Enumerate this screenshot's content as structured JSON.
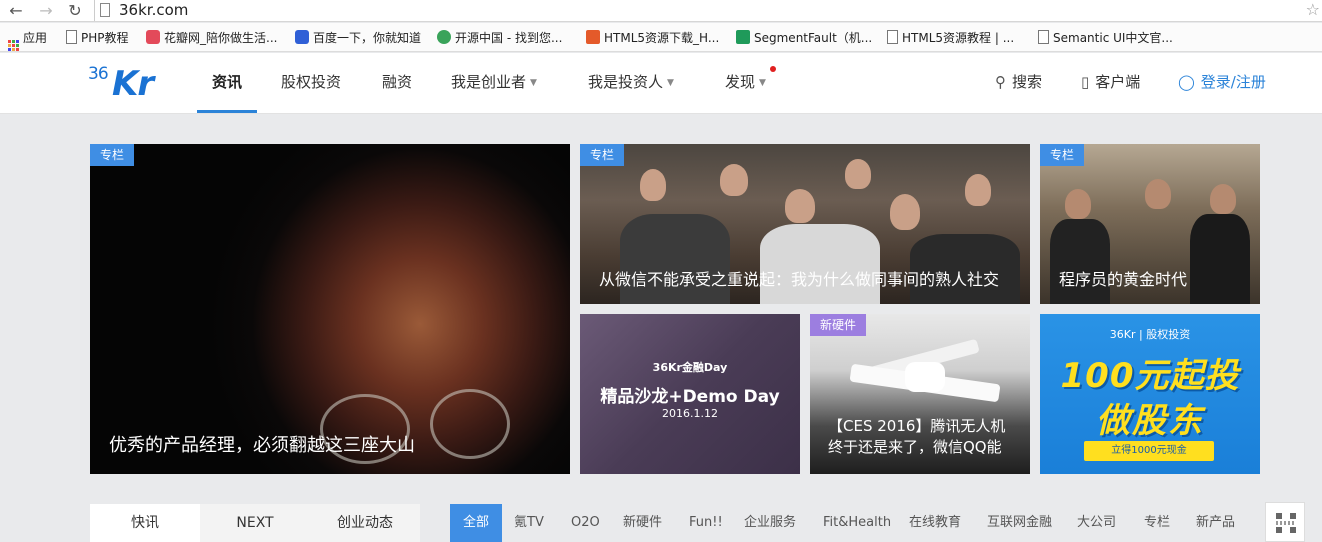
{
  "browser": {
    "url": "36kr.com",
    "bookmarks": [
      {
        "label": "应用",
        "icon": "apps-grid-icon"
      },
      {
        "label": "PHP教程",
        "icon": "page-icon"
      },
      {
        "label": "花瓣网_陪你做生活...",
        "icon": "huaban-icon"
      },
      {
        "label": "百度一下，你就知道",
        "icon": "baidu-paw-icon"
      },
      {
        "label": "开源中国 - 找到您...",
        "icon": "oschina-icon"
      },
      {
        "label": "HTML5资源下载_H...",
        "icon": "html5-icon"
      },
      {
        "label": "SegmentFault（机...",
        "icon": "segmentfault-icon"
      },
      {
        "label": "HTML5资源教程 | ...",
        "icon": "page-icon"
      },
      {
        "label": "Semantic UI中文官...",
        "icon": "page-icon"
      }
    ]
  },
  "header": {
    "logo_num": "36",
    "logo_kr": "Kr",
    "nav": [
      "资讯",
      "股权投资",
      "融资",
      "我是创业者",
      "我是投资人",
      "发现"
    ],
    "search": "搜索",
    "client": "客户端",
    "login": "登录/注册"
  },
  "cards": {
    "hero": {
      "tag": "专栏",
      "title": "优秀的产品经理，必须翻越这三座大山"
    },
    "c2": {
      "tag": "专栏",
      "title": "从微信不能承受之重说起：我为什么做同事间的熟人社交"
    },
    "c3": {
      "tag": "专栏",
      "title": "程序员的黄金时代"
    },
    "c4": {
      "line1": "36Kr金融Day",
      "line2": "精品沙龙+Demo Day",
      "line3": "2016.1.12"
    },
    "c5": {
      "tag": "新硬件",
      "title": "【CES 2016】腾讯无人机终于还是来了，微信QQ能"
    },
    "c6": {
      "head": "36Kr | 股权投资",
      "big1": "100元起投",
      "big2": "做股东",
      "button": "立得1000元现金"
    }
  },
  "tabs": [
    "快讯",
    "NEXT",
    "创业动态"
  ],
  "filters": [
    "全部",
    "氪TV",
    "O2O",
    "新硬件",
    "Fun!!",
    "企业服务",
    "Fit&Health",
    "在线教育",
    "互联网金融",
    "大公司",
    "专栏",
    "新产品"
  ],
  "colors": {
    "accent": "#3f8ee4",
    "brand": "#1a72d3",
    "tag_purple": "#9c7ee0",
    "promo_yellow": "#ffdf1f"
  }
}
